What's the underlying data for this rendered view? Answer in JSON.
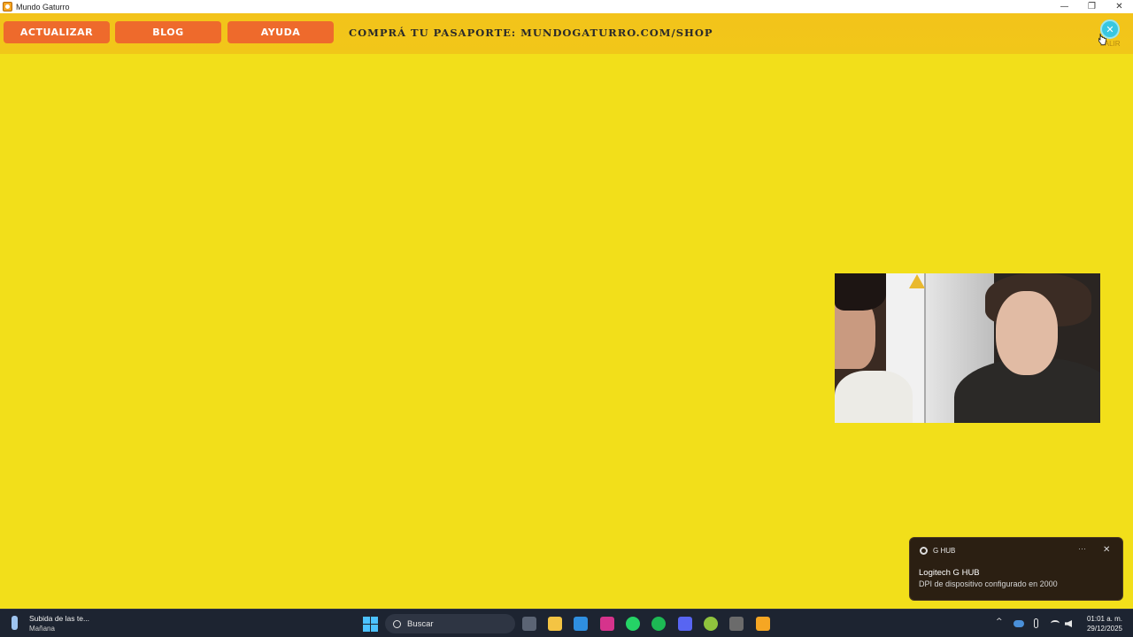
{
  "window": {
    "title": "Mundo Gaturro",
    "controls": {
      "minimize": "—",
      "maximize": "❐",
      "close": "✕"
    }
  },
  "toolbar": {
    "buttons": [
      {
        "label": "ACTUALIZAR"
      },
      {
        "label": "BLOG"
      },
      {
        "label": "AYUDA"
      }
    ],
    "promo": "COMPRÁ TU PASAPORTE: MUNDOGATURRO.COM/SHOP",
    "exit_label": "SALIR",
    "exit_icon": "close-icon"
  },
  "notification": {
    "app": "G HUB",
    "more": "···",
    "close": "✕",
    "title": "Logitech G HUB",
    "body": "DPI de dispositivo configurado en 2000"
  },
  "taskbar": {
    "widget_title": "Subida de las te...",
    "widget_subtitle": "Mañana",
    "search_placeholder": "Buscar",
    "pinned_apps": [
      {
        "icon": "task-view-icon",
        "color": "#5b6474"
      },
      {
        "icon": "file-explorer-icon",
        "color": "#f4c443"
      },
      {
        "icon": "remote-desktop-icon",
        "color": "#2f8fe0"
      },
      {
        "icon": "instagram-icon",
        "color": "#d6338c"
      },
      {
        "icon": "whatsapp-icon",
        "color": "#25d366"
      },
      {
        "icon": "spotify-icon",
        "color": "#1db954"
      },
      {
        "icon": "discord-icon",
        "color": "#5865f2"
      },
      {
        "icon": "xbox-icon",
        "color": "#8fc33d"
      },
      {
        "icon": "obs-icon",
        "color": "#6b6b6b"
      },
      {
        "icon": "mundo-gaturro-icon",
        "color": "#f5a623"
      }
    ],
    "tray": {
      "chevron": "^",
      "clock_time": "01:01 a. m.",
      "clock_date": "29/12/2025"
    }
  }
}
